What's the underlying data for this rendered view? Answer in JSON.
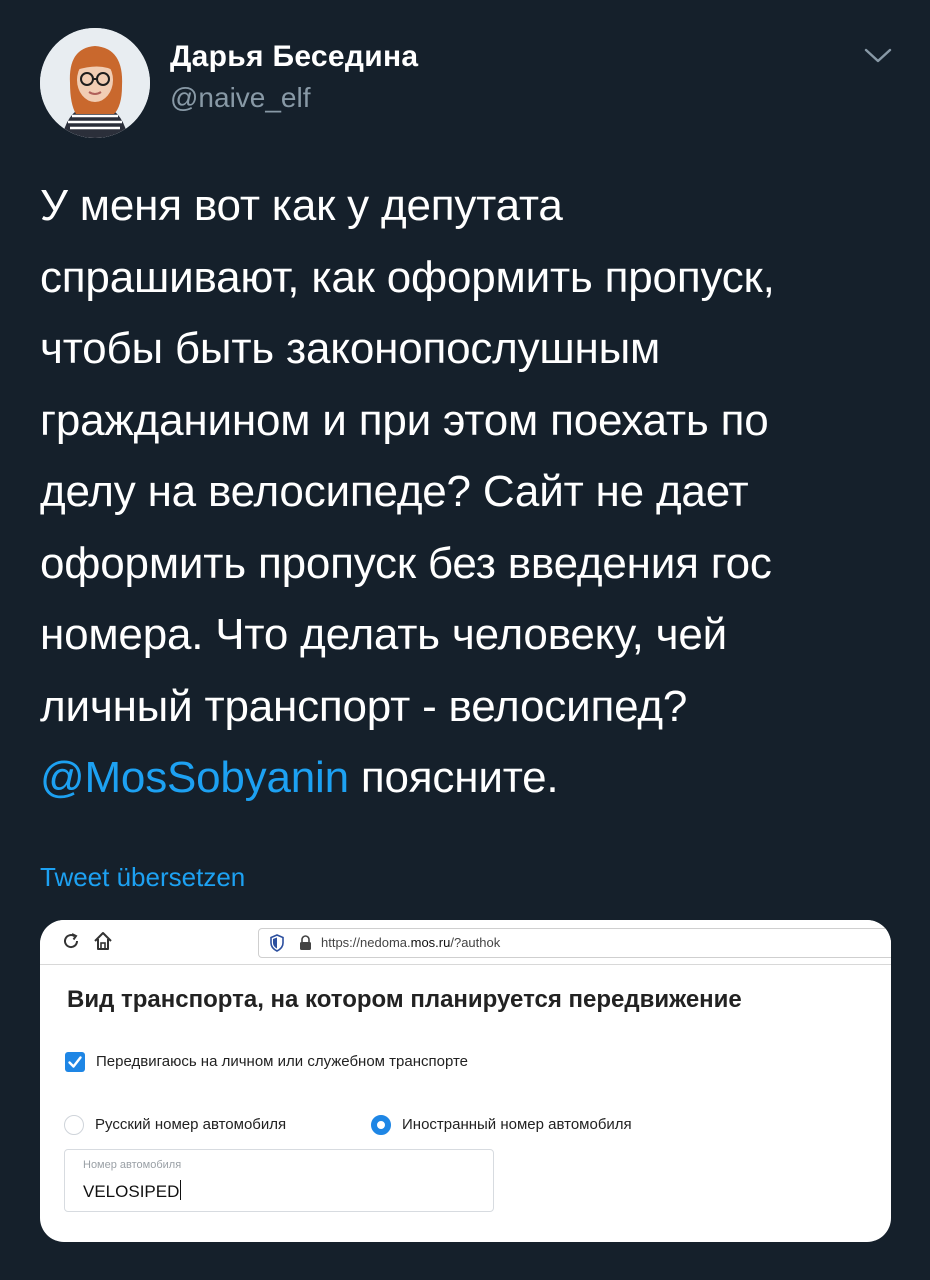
{
  "author": {
    "name": "Дарья Беседина",
    "handle": "@naive_elf"
  },
  "tweet": {
    "lines": [
      "У меня вот как у депутата",
      "спрашивают, как оформить пропуск,",
      "чтобы быть законопослушным",
      "гражданином и при этом поехать по",
      "делу на велосипеде? Сайт не дает",
      "оформить пропуск без введения гос",
      "номера. Что делать человеку, чей",
      "личный транспорт - велосипед?"
    ],
    "mention": "@MosSobyanin",
    "after_mention": " поясните.",
    "translate_label": "Tweet übersetzen"
  },
  "screenshot": {
    "url_prefix": "https://nedoma.",
    "url_host": "mos.ru",
    "url_suffix": "/?authok",
    "title": "Вид транспорта, на котором планируется передвижение",
    "checkbox_label": "Передвигаюсь на личном или служебном транспорте",
    "checkbox_checked": true,
    "radio_russian": "Русский номер автомобиля",
    "radio_foreign": "Иностранный номер автомобиля",
    "selected_radio": "Иностранный номер автомобиля",
    "plate_placeholder": "Номер автомобиля",
    "plate_value": "VELOSIPED"
  },
  "colors": {
    "background": "#15202b",
    "link": "#1da1f2",
    "secondary_text": "#8899a6",
    "accent_blue": "#1e86e5"
  },
  "icons": [
    "chevron-down-icon",
    "reload-icon",
    "home-icon",
    "shield-icon",
    "lock-icon",
    "checkmark-icon"
  ]
}
